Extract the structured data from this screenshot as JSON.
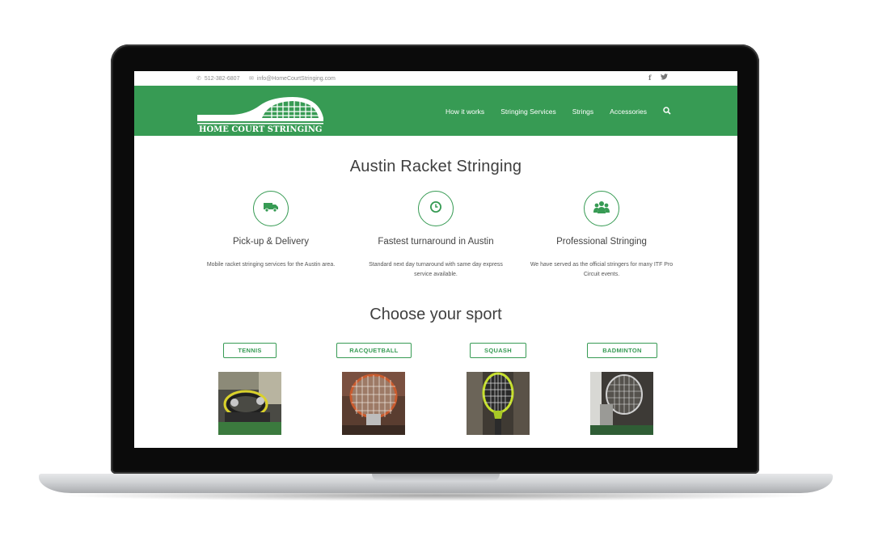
{
  "topbar": {
    "phone": "512-382-6807",
    "email": "info@HomeCourtStringing.com",
    "social": [
      "facebook-icon",
      "twitter-icon"
    ]
  },
  "header": {
    "logo_text": "HOME COURT STRINGING",
    "nav": [
      "How it works",
      "Stringing Services",
      "Strings",
      "Accessories"
    ],
    "brand_color": "#379b54"
  },
  "main": {
    "title": "Austin Racket Stringing",
    "features": [
      {
        "icon": "truck-icon",
        "title": "Pick-up & Delivery",
        "desc": "Mobile racket stringing services for the Austin area."
      },
      {
        "icon": "clock-icon",
        "title": "Fastest turnaround in Austin",
        "desc": "Standard next day turnaround with same day express service available."
      },
      {
        "icon": "group-icon",
        "title": "Professional Stringing",
        "desc": "We have served as the official stringers for many ITF Pro Circuit events."
      }
    ],
    "sports_title": "Choose your sport",
    "sports": [
      "TENNIS",
      "RACQUETBALL",
      "SQUASH",
      "BADMINTON"
    ]
  }
}
